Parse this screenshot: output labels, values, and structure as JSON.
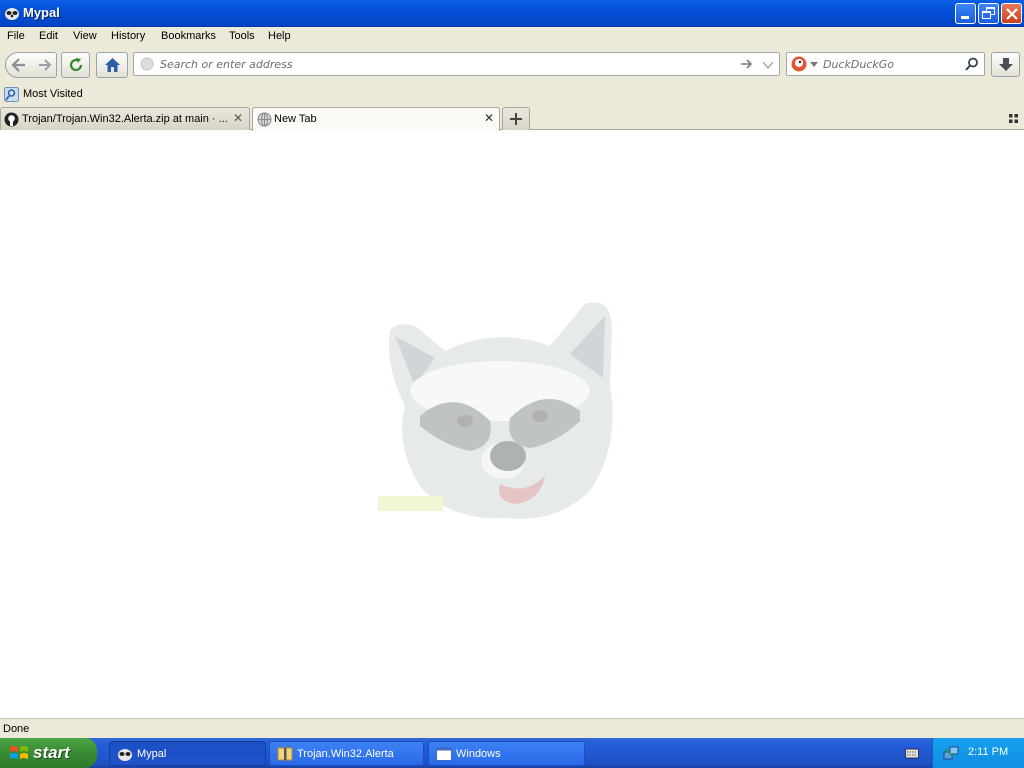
{
  "window": {
    "title": "Mypal"
  },
  "menu": [
    "File",
    "Edit",
    "View",
    "History",
    "Bookmarks",
    "Tools",
    "Help"
  ],
  "nav": {
    "url_placeholder": "Search or enter address",
    "search_engine": "DuckDuckGo"
  },
  "bookmarks": {
    "most_visited": "Most Visited"
  },
  "tabs": [
    {
      "label": "Trojan/Trojan.Win32.Alerta.zip at main · ..."
    },
    {
      "label": "New Tab"
    }
  ],
  "status": {
    "text": "Done"
  },
  "taskbar": {
    "start_label": "start",
    "items": [
      "Mypal",
      "Trojan.Win32.Alerta",
      "Windows"
    ],
    "clock": "2:11 PM"
  },
  "colors": {
    "accent": "#0450d8",
    "taskbar": "#245edb",
    "start": "#3b8f34"
  }
}
